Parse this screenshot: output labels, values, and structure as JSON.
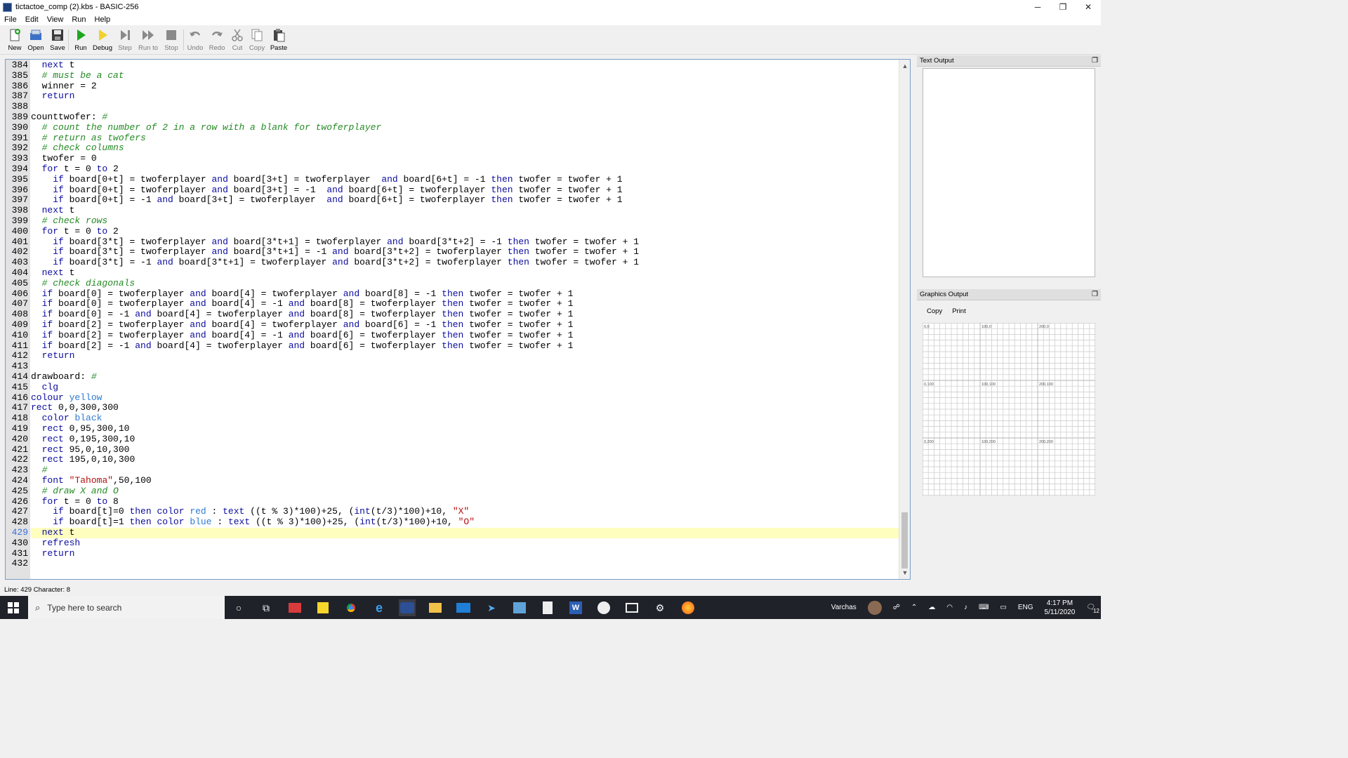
{
  "window": {
    "title": "tictactoe_comp (2).kbs - BASIC-256",
    "minimize": "─",
    "maximize": "❐",
    "close": "✕"
  },
  "menu": [
    "File",
    "Edit",
    "View",
    "Run",
    "Help"
  ],
  "toolbar": {
    "new": "New",
    "open": "Open",
    "save": "Save",
    "run": "Run",
    "debug": "Debug",
    "step": "Step",
    "run_to": "Run to",
    "stop": "Stop",
    "undo": "Undo",
    "redo": "Redo",
    "cut": "Cut",
    "copy": "Copy",
    "paste": "Paste"
  },
  "editor": {
    "current_line": 429,
    "lines": [
      {
        "n": 384,
        "code": [
          [
            "",
            "  "
          ],
          [
            "kw",
            "next"
          ],
          [
            "",
            " t"
          ]
        ]
      },
      {
        "n": 385,
        "code": [
          [
            "",
            "  "
          ],
          [
            "cm",
            "# must be a cat"
          ]
        ]
      },
      {
        "n": 386,
        "code": [
          [
            "",
            "  winner = 2"
          ]
        ]
      },
      {
        "n": 387,
        "code": [
          [
            "",
            "  "
          ],
          [
            "kw",
            "return"
          ]
        ]
      },
      {
        "n": 388,
        "code": []
      },
      {
        "n": 389,
        "code": [
          [
            "",
            "counttwofer: "
          ],
          [
            "cm",
            "#"
          ]
        ]
      },
      {
        "n": 390,
        "code": [
          [
            "",
            "  "
          ],
          [
            "cm",
            "# count the number of 2 in a row with a blank for twoferplayer"
          ]
        ]
      },
      {
        "n": 391,
        "code": [
          [
            "",
            "  "
          ],
          [
            "cm",
            "# return as twofers"
          ]
        ]
      },
      {
        "n": 392,
        "code": [
          [
            "",
            "  "
          ],
          [
            "cm",
            "# check columns"
          ]
        ]
      },
      {
        "n": 393,
        "code": [
          [
            "",
            "  twofer = 0"
          ]
        ]
      },
      {
        "n": 394,
        "code": [
          [
            "",
            "  "
          ],
          [
            "kw",
            "for"
          ],
          [
            "",
            " t = 0 "
          ],
          [
            "kw",
            "to"
          ],
          [
            "",
            " 2"
          ]
        ]
      },
      {
        "n": 395,
        "code": [
          [
            "",
            "    "
          ],
          [
            "kw",
            "if"
          ],
          [
            "",
            " board[0+t] = twoferplayer "
          ],
          [
            "kw",
            "and"
          ],
          [
            "",
            " board[3+t] = twoferplayer  "
          ],
          [
            "kw",
            "and"
          ],
          [
            "",
            " board[6+t] = -1 "
          ],
          [
            "kw",
            "then"
          ],
          [
            "",
            " twofer = twofer + 1"
          ]
        ]
      },
      {
        "n": 396,
        "code": [
          [
            "",
            "    "
          ],
          [
            "kw",
            "if"
          ],
          [
            "",
            " board[0+t] = twoferplayer "
          ],
          [
            "kw",
            "and"
          ],
          [
            "",
            " board[3+t] = -1  "
          ],
          [
            "kw",
            "and"
          ],
          [
            "",
            " board[6+t] = twoferplayer "
          ],
          [
            "kw",
            "then"
          ],
          [
            "",
            " twofer = twofer + 1"
          ]
        ]
      },
      {
        "n": 397,
        "code": [
          [
            "",
            "    "
          ],
          [
            "kw",
            "if"
          ],
          [
            "",
            " board[0+t] = -1 "
          ],
          [
            "kw",
            "and"
          ],
          [
            "",
            " board[3+t] = twoferplayer  "
          ],
          [
            "kw",
            "and"
          ],
          [
            "",
            " board[6+t] = twoferplayer "
          ],
          [
            "kw",
            "then"
          ],
          [
            "",
            " twofer = twofer + 1"
          ]
        ]
      },
      {
        "n": 398,
        "code": [
          [
            "",
            "  "
          ],
          [
            "kw",
            "next"
          ],
          [
            "",
            " t"
          ]
        ]
      },
      {
        "n": 399,
        "code": [
          [
            "",
            "  "
          ],
          [
            "cm",
            "# check rows"
          ]
        ]
      },
      {
        "n": 400,
        "code": [
          [
            "",
            "  "
          ],
          [
            "kw",
            "for"
          ],
          [
            "",
            " t = 0 "
          ],
          [
            "kw",
            "to"
          ],
          [
            "",
            " 2"
          ]
        ]
      },
      {
        "n": 401,
        "code": [
          [
            "",
            "    "
          ],
          [
            "kw",
            "if"
          ],
          [
            "",
            " board[3*t] = twoferplayer "
          ],
          [
            "kw",
            "and"
          ],
          [
            "",
            " board[3*t+1] = twoferplayer "
          ],
          [
            "kw",
            "and"
          ],
          [
            "",
            " board[3*t+2] = -1 "
          ],
          [
            "kw",
            "then"
          ],
          [
            "",
            " twofer = twofer + 1"
          ]
        ]
      },
      {
        "n": 402,
        "code": [
          [
            "",
            "    "
          ],
          [
            "kw",
            "if"
          ],
          [
            "",
            " board[3*t] = twoferplayer "
          ],
          [
            "kw",
            "and"
          ],
          [
            "",
            " board[3*t+1] = -1 "
          ],
          [
            "kw",
            "and"
          ],
          [
            "",
            " board[3*t+2] = twoferplayer "
          ],
          [
            "kw",
            "then"
          ],
          [
            "",
            " twofer = twofer + 1"
          ]
        ]
      },
      {
        "n": 403,
        "code": [
          [
            "",
            "    "
          ],
          [
            "kw",
            "if"
          ],
          [
            "",
            " board[3*t] = -1 "
          ],
          [
            "kw",
            "and"
          ],
          [
            "",
            " board[3*t+1] = twoferplayer "
          ],
          [
            "kw",
            "and"
          ],
          [
            "",
            " board[3*t+2] = twoferplayer "
          ],
          [
            "kw",
            "then"
          ],
          [
            "",
            " twofer = twofer + 1"
          ]
        ]
      },
      {
        "n": 404,
        "code": [
          [
            "",
            "  "
          ],
          [
            "kw",
            "next"
          ],
          [
            "",
            " t"
          ]
        ]
      },
      {
        "n": 405,
        "code": [
          [
            "",
            "  "
          ],
          [
            "cm",
            "# check diagonals"
          ]
        ]
      },
      {
        "n": 406,
        "code": [
          [
            "",
            "  "
          ],
          [
            "kw",
            "if"
          ],
          [
            "",
            " board[0] = twoferplayer "
          ],
          [
            "kw",
            "and"
          ],
          [
            "",
            " board[4] = twoferplayer "
          ],
          [
            "kw",
            "and"
          ],
          [
            "",
            " board[8] = -1 "
          ],
          [
            "kw",
            "then"
          ],
          [
            "",
            " twofer = twofer + 1"
          ]
        ]
      },
      {
        "n": 407,
        "code": [
          [
            "",
            "  "
          ],
          [
            "kw",
            "if"
          ],
          [
            "",
            " board[0] = twoferplayer "
          ],
          [
            "kw",
            "and"
          ],
          [
            "",
            " board[4] = -1 "
          ],
          [
            "kw",
            "and"
          ],
          [
            "",
            " board[8] = twoferplayer "
          ],
          [
            "kw",
            "then"
          ],
          [
            "",
            " twofer = twofer + 1"
          ]
        ]
      },
      {
        "n": 408,
        "code": [
          [
            "",
            "  "
          ],
          [
            "kw",
            "if"
          ],
          [
            "",
            " board[0] = -1 "
          ],
          [
            "kw",
            "and"
          ],
          [
            "",
            " board[4] = twoferplayer "
          ],
          [
            "kw",
            "and"
          ],
          [
            "",
            " board[8] = twoferplayer "
          ],
          [
            "kw",
            "then"
          ],
          [
            "",
            " twofer = twofer + 1"
          ]
        ]
      },
      {
        "n": 409,
        "code": [
          [
            "",
            "  "
          ],
          [
            "kw",
            "if"
          ],
          [
            "",
            " board[2] = twoferplayer "
          ],
          [
            "kw",
            "and"
          ],
          [
            "",
            " board[4] = twoferplayer "
          ],
          [
            "kw",
            "and"
          ],
          [
            "",
            " board[6] = -1 "
          ],
          [
            "kw",
            "then"
          ],
          [
            "",
            " twofer = twofer + 1"
          ]
        ]
      },
      {
        "n": 410,
        "code": [
          [
            "",
            "  "
          ],
          [
            "kw",
            "if"
          ],
          [
            "",
            " board[2] = twoferplayer "
          ],
          [
            "kw",
            "and"
          ],
          [
            "",
            " board[4] = -1 "
          ],
          [
            "kw",
            "and"
          ],
          [
            "",
            " board[6] = twoferplayer "
          ],
          [
            "kw",
            "then"
          ],
          [
            "",
            " twofer = twofer + 1"
          ]
        ]
      },
      {
        "n": 411,
        "code": [
          [
            "",
            "  "
          ],
          [
            "kw",
            "if"
          ],
          [
            "",
            " board[2] = -1 "
          ],
          [
            "kw",
            "and"
          ],
          [
            "",
            " board[4] = twoferplayer "
          ],
          [
            "kw",
            "and"
          ],
          [
            "",
            " board[6] = twoferplayer "
          ],
          [
            "kw",
            "then"
          ],
          [
            "",
            " twofer = twofer + 1"
          ]
        ]
      },
      {
        "n": 412,
        "code": [
          [
            "",
            "  "
          ],
          [
            "kw",
            "return"
          ]
        ]
      },
      {
        "n": 413,
        "code": []
      },
      {
        "n": 414,
        "code": [
          [
            "",
            "drawboard: "
          ],
          [
            "cm",
            "#"
          ]
        ]
      },
      {
        "n": 415,
        "code": [
          [
            "",
            "  "
          ],
          [
            "kw",
            "clg"
          ]
        ]
      },
      {
        "n": 416,
        "code": [
          [
            "kw",
            "colour"
          ],
          [
            "",
            " "
          ],
          [
            "cn",
            "yellow"
          ]
        ]
      },
      {
        "n": 417,
        "code": [
          [
            "kw",
            "rect"
          ],
          [
            "",
            " 0,0,300,300"
          ]
        ]
      },
      {
        "n": 418,
        "code": [
          [
            "",
            "  "
          ],
          [
            "kw",
            "color"
          ],
          [
            "",
            " "
          ],
          [
            "cn",
            "black"
          ]
        ]
      },
      {
        "n": 419,
        "code": [
          [
            "",
            "  "
          ],
          [
            "kw",
            "rect"
          ],
          [
            "",
            " 0,95,300,10"
          ]
        ]
      },
      {
        "n": 420,
        "code": [
          [
            "",
            "  "
          ],
          [
            "kw",
            "rect"
          ],
          [
            "",
            " 0,195,300,10"
          ]
        ]
      },
      {
        "n": 421,
        "code": [
          [
            "",
            "  "
          ],
          [
            "kw",
            "rect"
          ],
          [
            "",
            " 95,0,10,300"
          ]
        ]
      },
      {
        "n": 422,
        "code": [
          [
            "",
            "  "
          ],
          [
            "kw",
            "rect"
          ],
          [
            "",
            " 195,0,10,300"
          ]
        ]
      },
      {
        "n": 423,
        "code": [
          [
            "",
            "  "
          ],
          [
            "cm",
            "#"
          ]
        ]
      },
      {
        "n": 424,
        "code": [
          [
            "",
            "  "
          ],
          [
            "kw",
            "font"
          ],
          [
            "",
            " "
          ],
          [
            "st",
            "\"Tahoma\""
          ],
          [
            "",
            ",50,100"
          ]
        ]
      },
      {
        "n": 425,
        "code": [
          [
            "",
            "  "
          ],
          [
            "cm",
            "# draw X and O"
          ]
        ]
      },
      {
        "n": 426,
        "code": [
          [
            "",
            "  "
          ],
          [
            "kw",
            "for"
          ],
          [
            "",
            " t = 0 "
          ],
          [
            "kw",
            "to"
          ],
          [
            "",
            " 8"
          ]
        ]
      },
      {
        "n": 427,
        "code": [
          [
            "",
            "    "
          ],
          [
            "kw",
            "if"
          ],
          [
            "",
            " board[t]=0 "
          ],
          [
            "kw",
            "then"
          ],
          [
            "",
            " "
          ],
          [
            "kw",
            "color"
          ],
          [
            "",
            " "
          ],
          [
            "cn",
            "red"
          ],
          [
            "",
            " : "
          ],
          [
            "kw",
            "text"
          ],
          [
            "",
            " ((t % 3)*100)+25, ("
          ],
          [
            "kw",
            "int"
          ],
          [
            "",
            "(t/3)*100)+10, "
          ],
          [
            "st",
            "\"X\""
          ]
        ]
      },
      {
        "n": 428,
        "code": [
          [
            "",
            "    "
          ],
          [
            "kw",
            "if"
          ],
          [
            "",
            " board[t]=1 "
          ],
          [
            "kw",
            "then"
          ],
          [
            "",
            " "
          ],
          [
            "kw",
            "color"
          ],
          [
            "",
            " "
          ],
          [
            "cn",
            "blue"
          ],
          [
            "",
            " : "
          ],
          [
            "kw",
            "text"
          ],
          [
            "",
            " ((t % 3)*100)+25, ("
          ],
          [
            "kw",
            "int"
          ],
          [
            "",
            "(t/3)*100)+10, "
          ],
          [
            "st",
            "\"O\""
          ]
        ]
      },
      {
        "n": 429,
        "code": [
          [
            "",
            "  "
          ],
          [
            "kw",
            "next"
          ],
          [
            "",
            " t"
          ]
        ]
      },
      {
        "n": 430,
        "code": [
          [
            "",
            "  "
          ],
          [
            "kw",
            "refresh"
          ]
        ]
      },
      {
        "n": 431,
        "code": [
          [
            "",
            "  "
          ],
          [
            "kw",
            "return"
          ]
        ]
      },
      {
        "n": 432,
        "code": []
      }
    ]
  },
  "status": {
    "position": "Line: 429 Character: 8"
  },
  "text_output": {
    "title": "Text Output",
    "dock_icon": "❐"
  },
  "graphics_output": {
    "title": "Graphics Output",
    "dock_icon": "❐",
    "copy": "Copy",
    "print": "Print",
    "grid_labels": [
      "0,0",
      "100,0",
      "200,0",
      "0,100",
      "100,100",
      "200,100",
      "0,200",
      "100,200",
      "200,200"
    ]
  },
  "taskbar": {
    "search_placeholder": "Type here to search",
    "user": "Varchas",
    "language": "ENG",
    "time": "4:17 PM",
    "date": "5/11/2020",
    "notifications": "12"
  },
  "colors": {
    "keyword": "#0b0b9f",
    "comment": "#248a24",
    "string": "#b21010",
    "color_const": "#2e7bd0",
    "current_line": "#fefebf"
  }
}
